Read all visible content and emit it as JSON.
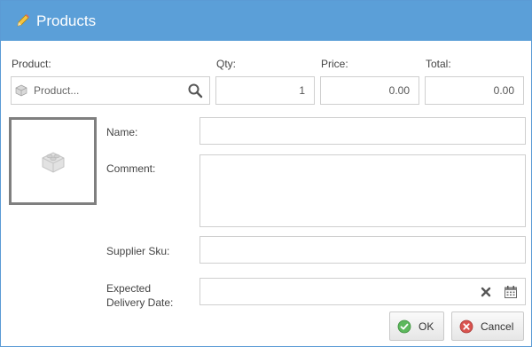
{
  "dialog": {
    "title": "Products",
    "title_icon": "pencil-icon"
  },
  "form": {
    "product": {
      "label": "Product:",
      "placeholder": "Product...",
      "value": ""
    },
    "qty": {
      "label": "Qty:",
      "value": "1"
    },
    "price": {
      "label": "Price:",
      "value": "0.00"
    },
    "total": {
      "label": "Total:",
      "value": "0.00"
    },
    "name": {
      "label": "Name:",
      "value": ""
    },
    "comment": {
      "label": "Comment:",
      "value": ""
    },
    "supplier_sku": {
      "label": "Supplier Sku:",
      "value": ""
    },
    "expected_delivery_date": {
      "label_line1": "Expected",
      "label_line2": "Delivery Date:",
      "value": ""
    }
  },
  "buttons": {
    "ok_label": "OK",
    "cancel_label": "Cancel"
  },
  "colors": {
    "titlebar": "#5b9fd8",
    "ok_icon": "#5cb85c",
    "cancel_icon": "#d9534f"
  }
}
